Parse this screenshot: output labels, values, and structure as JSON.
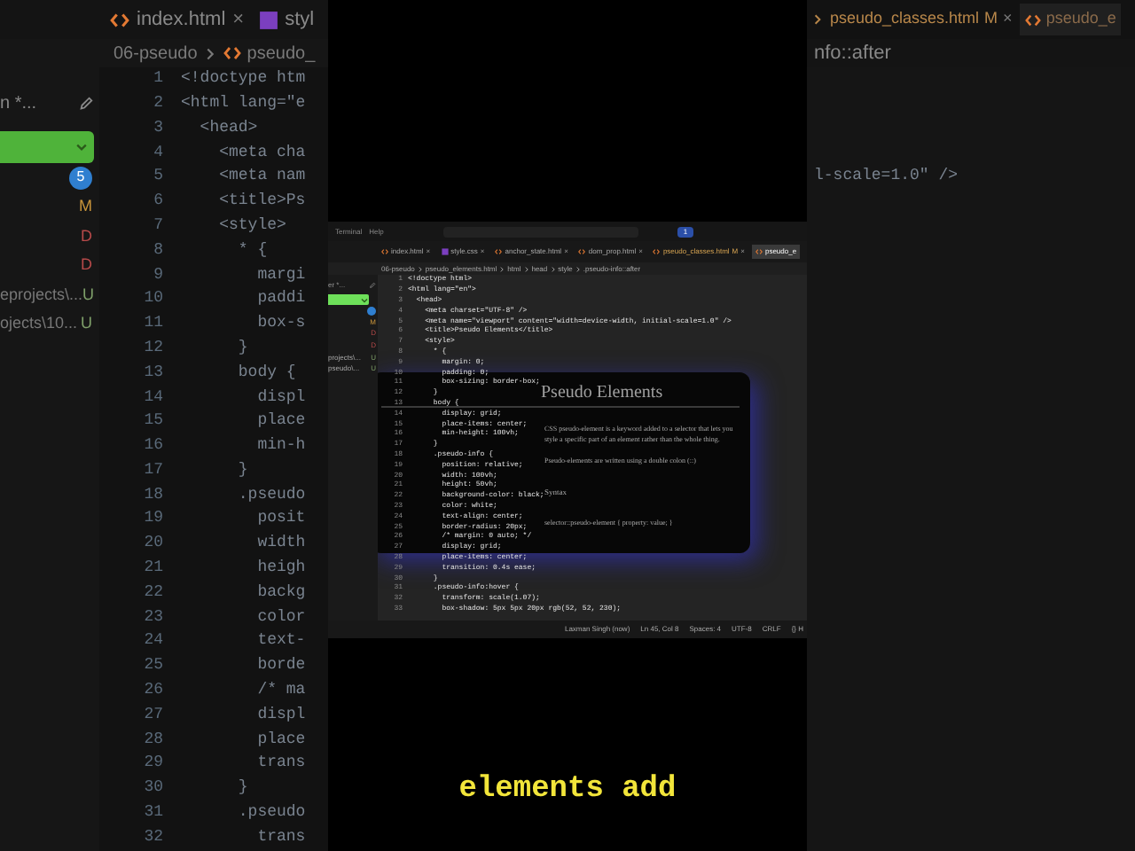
{
  "backdrop_left": {
    "tabs": [
      {
        "kind": "html",
        "label": "index.html",
        "close": "×",
        "selected": false
      },
      {
        "kind": "css",
        "label": "styl",
        "selected": false
      }
    ],
    "breadcrumb": [
      "06-pseudo",
      "pseudo_"
    ],
    "filter_text": "n *...",
    "changes": [
      {
        "kind": "count",
        "badge": "5"
      },
      {
        "kind": "modified",
        "badge": "M"
      },
      {
        "kind": "deleted",
        "badge": "D"
      },
      {
        "kind": "deleted",
        "badge": "D"
      },
      {
        "kind": "untracked",
        "label": "eprojects\\...",
        "badge": "U"
      },
      {
        "kind": "untracked",
        "label": "ojects\\10...",
        "badge": "U"
      }
    ],
    "code_lines": [
      {
        "number": "1",
        "text": "<!doctype htm"
      },
      {
        "number": "2",
        "text": "<html lang=\"e"
      },
      {
        "number": "3",
        "text": "  <head>"
      },
      {
        "number": "4",
        "text": "    <meta cha"
      },
      {
        "number": "5",
        "text": "    <meta nam"
      },
      {
        "number": "6",
        "text": "    <title>Ps"
      },
      {
        "number": "7",
        "text": "    <style>"
      },
      {
        "number": "8",
        "text": "      * {"
      },
      {
        "number": "9",
        "text": "        margi"
      },
      {
        "number": "10",
        "text": "        paddi"
      },
      {
        "number": "11",
        "text": "        box-s"
      },
      {
        "number": "12",
        "text": "      }"
      },
      {
        "number": "13",
        "text": "      body {"
      },
      {
        "number": "14",
        "text": "        displ"
      },
      {
        "number": "15",
        "text": "        place"
      },
      {
        "number": "16",
        "text": "        min-h"
      },
      {
        "number": "17",
        "text": "      }"
      },
      {
        "number": "18",
        "text": "      .pseudo"
      },
      {
        "number": "19",
        "text": "        posit"
      },
      {
        "number": "20",
        "text": "        width"
      },
      {
        "number": "21",
        "text": "        heigh"
      },
      {
        "number": "22",
        "text": "        backg"
      },
      {
        "number": "23",
        "text": "        color"
      },
      {
        "number": "24",
        "text": "        text-"
      },
      {
        "number": "25",
        "text": "        borde"
      },
      {
        "number": "26",
        "text": "        /* ma"
      },
      {
        "number": "27",
        "text": "        displ"
      },
      {
        "number": "28",
        "text": "        place"
      },
      {
        "number": "29",
        "text": "        trans"
      },
      {
        "number": "30",
        "text": "      }"
      },
      {
        "number": "31",
        "text": "      .pseudo"
      },
      {
        "number": "32",
        "text": "        trans"
      }
    ]
  },
  "editor": {
    "menu": [
      "Terminal",
      "Help"
    ],
    "notification_count": "1",
    "tabs": [
      {
        "kind": "html",
        "label": "index.html",
        "close": "×",
        "selected": false
      },
      {
        "kind": "css",
        "label": "style.css",
        "close": "×",
        "selected": false
      },
      {
        "kind": "html",
        "label": "anchor_state.html",
        "close": "×",
        "selected": false
      },
      {
        "kind": "html",
        "label": "dom_prop.html",
        "close": "×",
        "selected": false
      },
      {
        "kind": "html",
        "label": "pseudo_classes.html",
        "badge": "M",
        "close": "×",
        "selected": false
      },
      {
        "kind": "html",
        "label": "pseudo_e",
        "selected": true
      }
    ],
    "breadcrumb": [
      "06-pseudo",
      "pseudo_elements.html",
      "html",
      "head",
      "style",
      ".pseudo-info::after"
    ],
    "filter_text": "er *...",
    "changes": [
      {
        "kind": "count"
      },
      {
        "kind": "modified",
        "badge": "M"
      },
      {
        "kind": "deleted",
        "badge": "D"
      },
      {
        "kind": "deleted",
        "badge": "D"
      },
      {
        "kind": "untracked",
        "label": "projects\\...",
        "badge": "U"
      },
      {
        "kind": "untracked",
        "label": "pseudo\\...",
        "badge": "U"
      }
    ],
    "code_lines": [
      {
        "number": "1",
        "text": "<!doctype html>"
      },
      {
        "number": "2",
        "text": "<html lang=\"en\">"
      },
      {
        "number": "3",
        "text": "  <head>"
      },
      {
        "number": "4",
        "text": "    <meta charset=\"UTF-8\" />"
      },
      {
        "number": "5",
        "text": "    <meta name=\"viewport\" content=\"width=device-width, initial-scale=1.0\" />"
      },
      {
        "number": "6",
        "text": "    <title>Pseudo Elements</title>"
      },
      {
        "number": "7",
        "text": "    <style>"
      },
      {
        "number": "8",
        "text": "      * {"
      },
      {
        "number": "9",
        "text": "        margin: 0;"
      },
      {
        "number": "10",
        "text": "        padding: 0;"
      },
      {
        "number": "11",
        "text": "        box-sizing: border-box;"
      },
      {
        "number": "12",
        "text": "      }"
      },
      {
        "number": "13",
        "text": "      body {"
      },
      {
        "number": "14",
        "text": "        display: grid;"
      },
      {
        "number": "15",
        "text": "        place-items: center;"
      },
      {
        "number": "16",
        "text": "        min-height: 100vh;"
      },
      {
        "number": "17",
        "text": "      }"
      },
      {
        "number": "18",
        "text": "      .pseudo-info {"
      },
      {
        "number": "19",
        "text": "        position: relative;"
      },
      {
        "number": "20",
        "text": "        width: 100vh;"
      },
      {
        "number": "21",
        "text": "        height: 50vh;"
      },
      {
        "number": "22",
        "text": "        background-color: black;"
      },
      {
        "number": "23",
        "text": "        color: white;"
      },
      {
        "number": "24",
        "text": "        text-align: center;"
      },
      {
        "number": "25",
        "text": "        border-radius: 20px;"
      },
      {
        "number": "26",
        "text": "        /* margin: 0 auto; */"
      },
      {
        "number": "27",
        "text": "        display: grid;"
      },
      {
        "number": "28",
        "text": "        place-items: center;"
      },
      {
        "number": "29",
        "text": "        transition: 0.4s ease;"
      },
      {
        "number": "30",
        "text": "      }"
      },
      {
        "number": "31",
        "text": "      .pseudo-info:hover {"
      },
      {
        "number": "32",
        "text": "        transform: scale(1.07);"
      },
      {
        "number": "33",
        "text": "        box-shadow: 5px 5px 20px rgb(52, 52, 230);"
      }
    ],
    "preview_card": {
      "title": "Pseudo Elements",
      "paragraphs": [
        "CSS pseudo-element is a keyword added to a selector that lets you style a specific part of an element rather than the whole thing.",
        "Pseudo-elements are written using a double colon (::)"
      ],
      "heading": "Syntax",
      "syntax": "selector::pseudo-element { property: value; }"
    },
    "status_bar": [
      "Laxman Singh (now)",
      "Ln 45, Col 8",
      "Spaces: 4",
      "UTF-8",
      "CRLF",
      "{} H"
    ]
  },
  "backdrop_right": {
    "tab": {
      "label": "pseudo_classes.html",
      "badge": "M",
      "close": "×"
    },
    "active_tab": {
      "label": "pseudo_e",
      "selected": true
    },
    "breadcrumb": "nfo::after",
    "code_fragment": "l-scale=1.0\" />"
  },
  "caption": "elements add"
}
